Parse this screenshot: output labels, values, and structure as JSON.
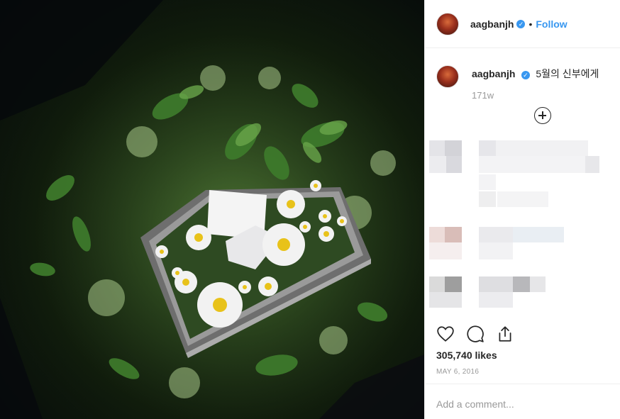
{
  "post": {
    "username": "aagbanjh",
    "verified_mark": "✓",
    "separator": "•",
    "follow_label": "Follow",
    "caption": "5월의 신부에게",
    "time_ago": "171w",
    "likes": "305,740 likes",
    "date": "MAY 6, 2016",
    "comment_placeholder": "Add a comment..."
  },
  "icons": {
    "avatar": "profile-avatar",
    "verified": "verified-badge-icon",
    "load_more": "plus-circle-icon",
    "like": "heart-icon",
    "comment": "speech-bubble-icon",
    "share": "share-icon"
  },
  "colors": {
    "accent": "#3897f0",
    "text": "#262626",
    "muted": "#999999",
    "divider": "#efefef"
  }
}
